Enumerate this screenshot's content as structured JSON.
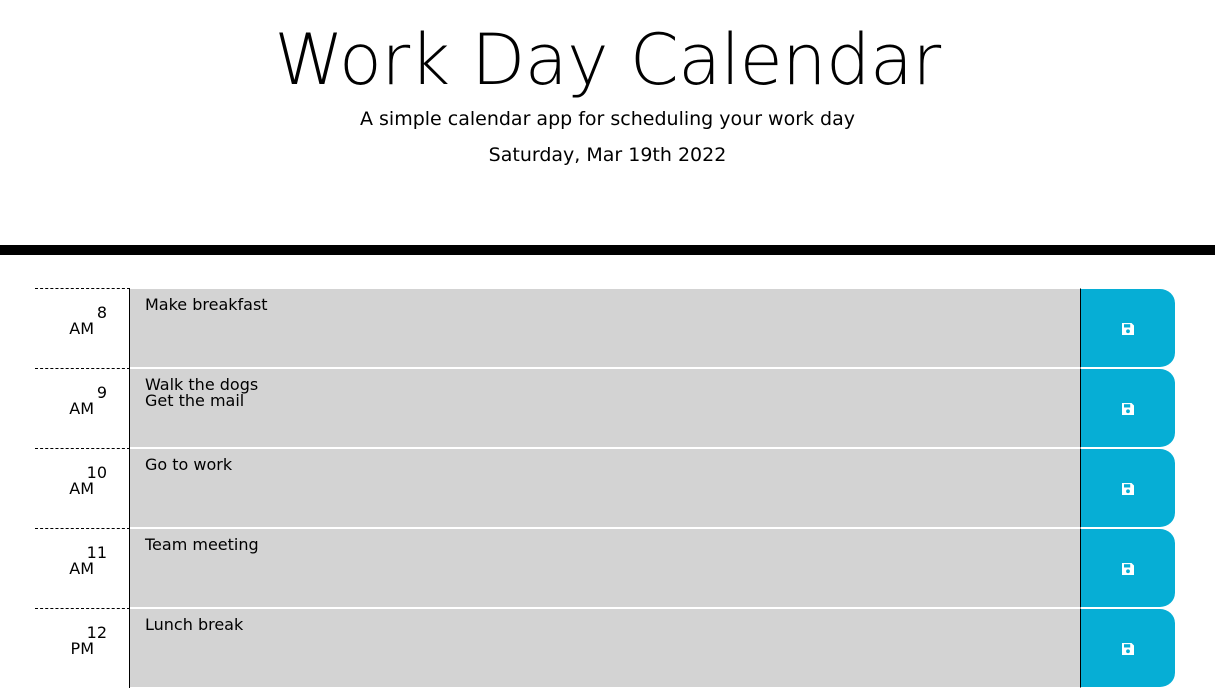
{
  "header": {
    "title": "Work Day Calendar",
    "subtitle": "A simple calendar app for scheduling your work day",
    "current_day": "Saturday, Mar 19th 2022"
  },
  "colors": {
    "past_row": "#d3d3d3",
    "save_button": "#06aed5",
    "divider": "#000000"
  },
  "icons": {
    "save": "floppy-disk-icon"
  },
  "time_blocks": [
    {
      "hour": "8",
      "period": "AM",
      "text": "Make breakfast"
    },
    {
      "hour": "9",
      "period": "AM",
      "text": "Walk the dogs\nGet the mail"
    },
    {
      "hour": "10",
      "period": "AM",
      "text": "Go to work"
    },
    {
      "hour": "11",
      "period": "AM",
      "text": "Team meeting"
    },
    {
      "hour": "12",
      "period": "PM",
      "text": "Lunch break"
    }
  ]
}
